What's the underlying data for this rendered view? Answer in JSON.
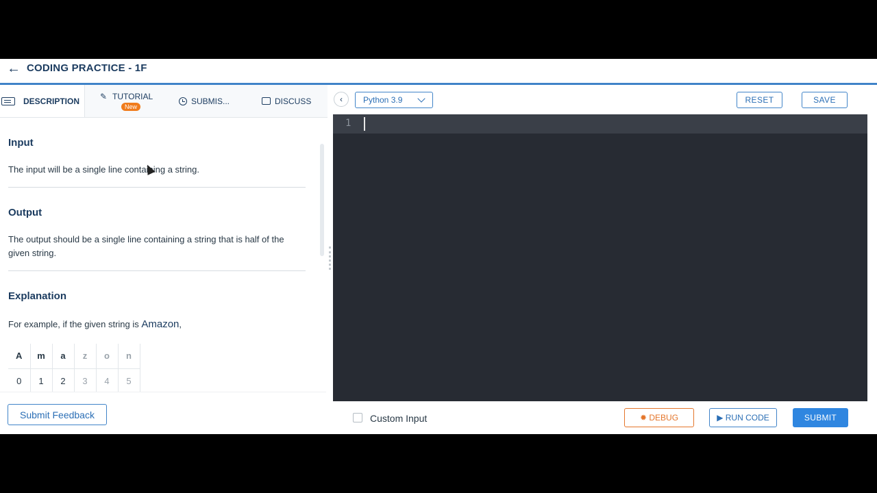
{
  "header": {
    "back_icon": "←",
    "title": "CODING PRACTICE - 1F"
  },
  "tabs": {
    "description": "DESCRIPTION",
    "tutorial": "TUTORIAL",
    "tutorial_badge": "New",
    "submissions": "SUBMIS...",
    "discuss": "DISCUSS"
  },
  "problem": {
    "input_title": "Input",
    "input_text": "The input will be a single line containing a string.",
    "output_title": "Output",
    "output_text": "The output should be a single line containing a string that is half of the given string.",
    "explanation_title": "Explanation",
    "example_prefix": "For example, if the given string is ",
    "example_word": "Amazon",
    "example_suffix": ",",
    "letters": [
      "A",
      "m",
      "a",
      "z",
      "o",
      "n"
    ],
    "indices": [
      "0",
      "1",
      "2",
      "3",
      "4",
      "5"
    ]
  },
  "left_footer": {
    "feedback_label": "Submit Feedback"
  },
  "editor_toolbar": {
    "collapse_icon": "‹",
    "language": "Python 3.9",
    "reset_label": "RESET",
    "save_label": "SAVE"
  },
  "editor": {
    "line_number": "1"
  },
  "editor_footer": {
    "custom_input_label": "Custom Input",
    "debug_label": "✹ DEBUG",
    "run_label": "▶ RUN CODE",
    "submit_label": "SUBMIT"
  }
}
